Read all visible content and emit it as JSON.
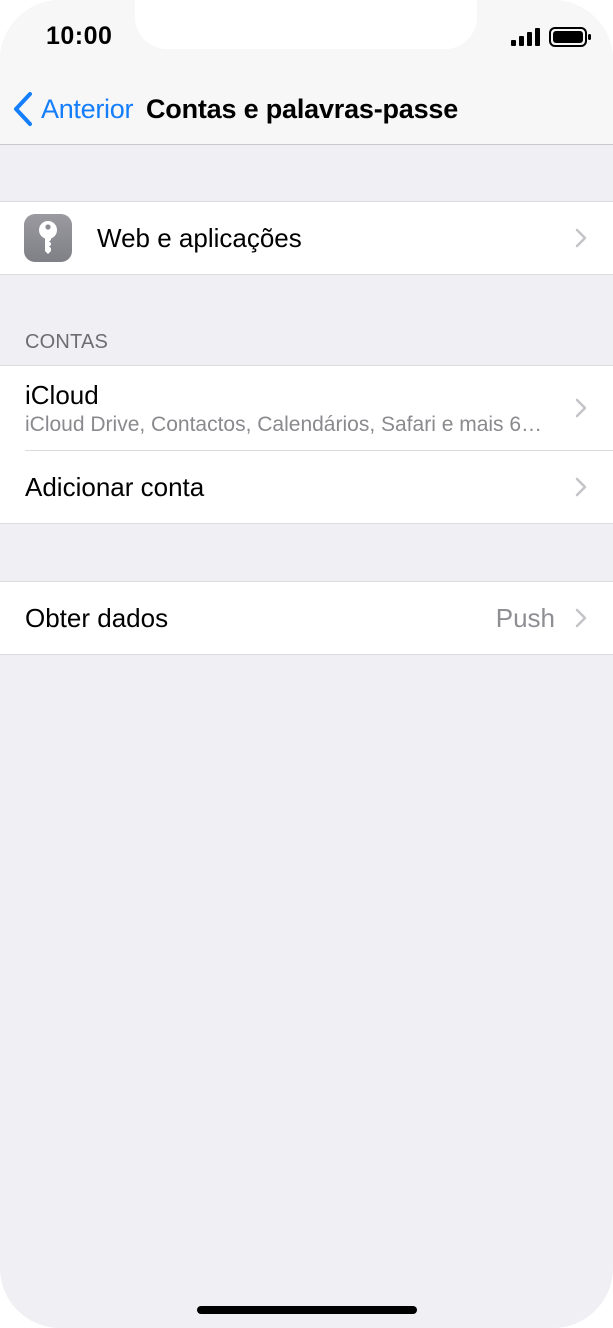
{
  "status_bar": {
    "time": "10:00"
  },
  "nav": {
    "back_label": "Anterior",
    "title": "Contas e palavras-passe"
  },
  "web_apps": {
    "label": "Web e aplicações",
    "icon": "key-icon"
  },
  "accounts": {
    "header": "CONTAS",
    "items": [
      {
        "title": "iCloud",
        "subtitle": "iCloud Drive, Contactos, Calendários, Safari e mais 6…"
      },
      {
        "title": "Adicionar conta"
      }
    ]
  },
  "fetch": {
    "label": "Obter dados",
    "value": "Push"
  },
  "colors": {
    "accent": "#157efb",
    "background": "#efeff4",
    "secondary_text": "#8e8e93"
  }
}
